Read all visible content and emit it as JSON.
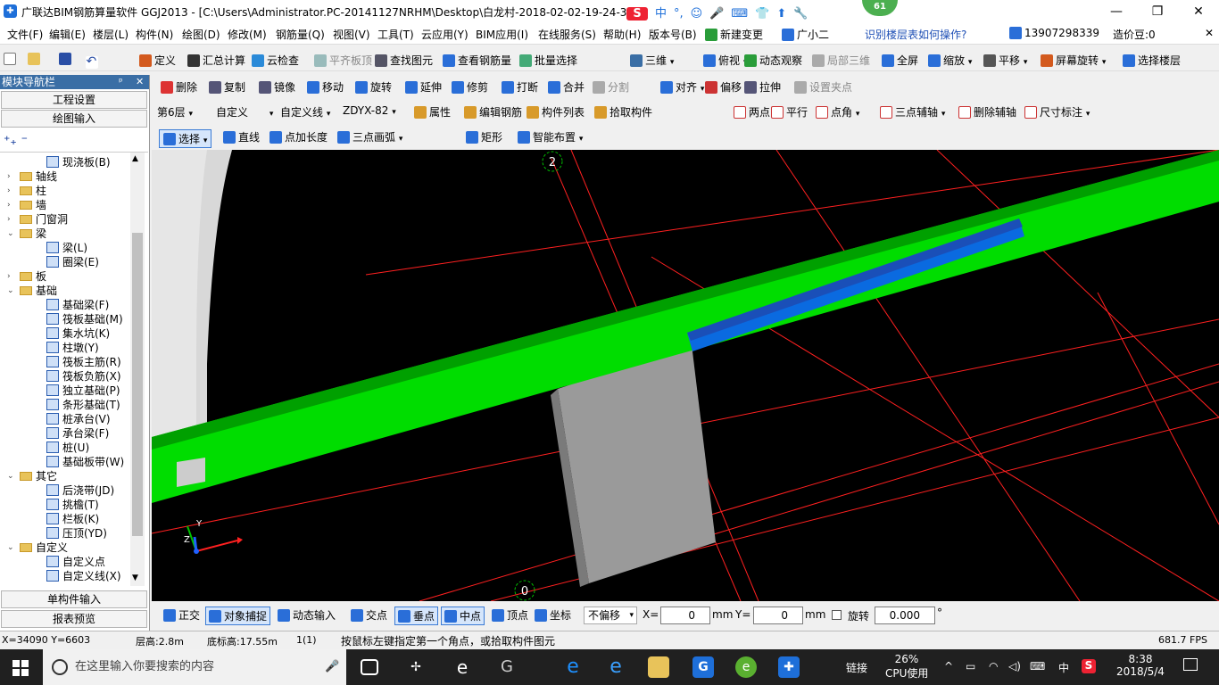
{
  "window": {
    "title": "广联达BIM钢筋算量软件 GGJ2013 - [C:\\Users\\Administrator.PC-20141127NRHM\\Desktop\\白龙村-2018-02-02-19-24-35",
    "badge": "61",
    "min": "—",
    "max": "❐",
    "close": "✕"
  },
  "ime": {
    "s": "S",
    "mode": "中",
    "punct": "°,",
    "face": "☺",
    "mic": "🎤",
    "kbd": "⌨",
    "shirt": "👕",
    "arrow": "⬆",
    "tool": "🔧"
  },
  "menu": [
    "文件(F)",
    "编辑(E)",
    "楼层(L)",
    "构件(N)",
    "绘图(D)",
    "修改(M)",
    "钢筋量(Q)",
    "视图(V)",
    "工具(T)",
    "云应用(Y)",
    "BIM应用(I)",
    "在线服务(S)",
    "帮助(H)",
    "版本号(B)",
    "新建变更",
    "广小二"
  ],
  "menu_right": {
    "hint": "识别楼层表如何操作?",
    "phone": "13907298339",
    "bean": "造价豆:0"
  },
  "toolbar1": [
    "定义",
    "汇总计算",
    "云检查",
    "平齐板顶",
    "查找图元",
    "查看钢筋量",
    "批量选择",
    "三维",
    "俯视",
    "动态观察",
    "局部三维",
    "全屏",
    "缩放",
    "平移",
    "屏幕旋转",
    "选择楼层"
  ],
  "nav": {
    "title": "模块导航栏",
    "pin": "ᵖ",
    "close": "✕",
    "btn_setup": "工程设置",
    "btn_draw": "绘图输入",
    "btn_single": "单构件输入",
    "btn_report": "报表预览"
  },
  "tree": [
    {
      "t": "leaf",
      "label": "现浇板(B)",
      "indent": 2
    },
    {
      "t": "folder",
      "label": "轴线",
      "indent": 1,
      "exp": ">"
    },
    {
      "t": "folder",
      "label": "柱",
      "indent": 1,
      "exp": ">"
    },
    {
      "t": "folder",
      "label": "墙",
      "indent": 1,
      "exp": ">"
    },
    {
      "t": "folder",
      "label": "门窗洞",
      "indent": 1,
      "exp": ">"
    },
    {
      "t": "folder",
      "label": "梁",
      "indent": 1,
      "exp": "v"
    },
    {
      "t": "leaf",
      "label": "梁(L)",
      "indent": 2
    },
    {
      "t": "leaf",
      "label": "圈梁(E)",
      "indent": 2
    },
    {
      "t": "folder",
      "label": "板",
      "indent": 1,
      "exp": ">"
    },
    {
      "t": "folder",
      "label": "基础",
      "indent": 1,
      "exp": "v"
    },
    {
      "t": "leaf",
      "label": "基础梁(F)",
      "indent": 2
    },
    {
      "t": "leaf",
      "label": "筏板基础(M)",
      "indent": 2
    },
    {
      "t": "leaf",
      "label": "集水坑(K)",
      "indent": 2
    },
    {
      "t": "leaf",
      "label": "柱墩(Y)",
      "indent": 2
    },
    {
      "t": "leaf",
      "label": "筏板主筋(R)",
      "indent": 2
    },
    {
      "t": "leaf",
      "label": "筏板负筋(X)",
      "indent": 2
    },
    {
      "t": "leaf",
      "label": "独立基础(P)",
      "indent": 2
    },
    {
      "t": "leaf",
      "label": "条形基础(T)",
      "indent": 2
    },
    {
      "t": "leaf",
      "label": "桩承台(V)",
      "indent": 2
    },
    {
      "t": "leaf",
      "label": "承台梁(F)",
      "indent": 2
    },
    {
      "t": "leaf",
      "label": "桩(U)",
      "indent": 2
    },
    {
      "t": "leaf",
      "label": "基础板带(W)",
      "indent": 2
    },
    {
      "t": "folder",
      "label": "其它",
      "indent": 1,
      "exp": "v"
    },
    {
      "t": "leaf",
      "label": "后浇带(JD)",
      "indent": 2
    },
    {
      "t": "leaf",
      "label": "挑檐(T)",
      "indent": 2
    },
    {
      "t": "leaf",
      "label": "栏板(K)",
      "indent": 2
    },
    {
      "t": "leaf",
      "label": "压顶(YD)",
      "indent": 2
    },
    {
      "t": "folder",
      "label": "自定义",
      "indent": 1,
      "exp": "v"
    },
    {
      "t": "leaf",
      "label": "自定义点",
      "indent": 2
    },
    {
      "t": "leaf",
      "label": "自定义线(X)",
      "indent": 2
    }
  ],
  "toolbar2": [
    "删除",
    "复制",
    "镜像",
    "移动",
    "旋转",
    "延伸",
    "修剪",
    "打断",
    "合并",
    "分割",
    "对齐",
    "偏移",
    "拉伸",
    "设置夹点"
  ],
  "toolbar3": {
    "floor": "第6层",
    "type": "自定义",
    "subtype": "自定义线",
    "name": "ZDYX-82",
    "items": [
      "属性",
      "编辑钢筋",
      "构件列表",
      "拾取构件"
    ],
    "right": [
      "两点",
      "平行",
      "点角",
      "三点辅轴",
      "删除辅轴",
      "尺寸标注"
    ]
  },
  "toolbar4": [
    "选择",
    "直线",
    "点加长度",
    "三点画弧",
    "矩形",
    "智能布置"
  ],
  "viewport": {
    "axis_top": "2",
    "axis_bottom": "0",
    "axis_y": "Y",
    "axis_z": "Z"
  },
  "snap": {
    "items": [
      "正交",
      "对象捕捉",
      "动态输入",
      "交点",
      "垂点",
      "中点",
      "顶点",
      "坐标"
    ],
    "offset": "不偏移",
    "x_label": "X=",
    "x_val": "0",
    "unit1": "mm",
    "y_label": "Y=",
    "y_val": "0",
    "unit2": "mm",
    "rot_label": "旋转",
    "rot_val": "0.000",
    "deg": "°"
  },
  "status": {
    "coords": "X=34090 Y=6603",
    "floor_h": "层高:2.8m",
    "base_h": "底标高:17.55m",
    "count": "1(1)",
    "hint": "按鼠标左键指定第一个角点，或拾取构件图元",
    "fps": "681.7 FPS"
  },
  "taskbar": {
    "search_ph": "在这里输入你要搜索的内容",
    "link": "链接",
    "cpu_pct": "26%",
    "cpu_label": "CPU使用",
    "lang": "中",
    "time": "8:38",
    "date": "2018/5/4"
  },
  "colors": {
    "beam": "#00dd00",
    "blue_beam": "#0a6ae0",
    "column": "#9a9a9a",
    "axis": "#ff2020",
    "nav_title": "#3a6ea5"
  }
}
